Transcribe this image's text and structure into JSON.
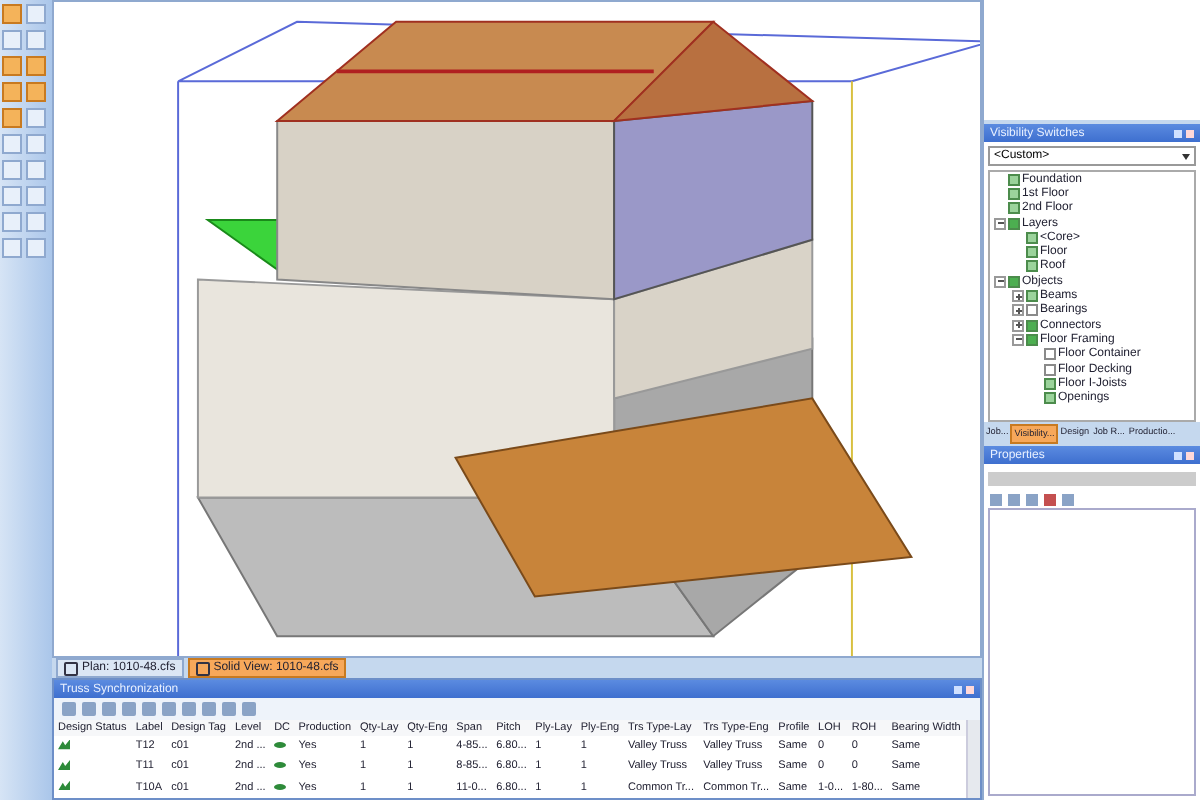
{
  "left_toolbar": {
    "tools": [
      {
        "selected": true
      },
      {
        "selected": false
      },
      {
        "selected": false
      },
      {
        "selected": false
      },
      {
        "selected": true
      },
      {
        "selected": true
      },
      {
        "selected": true
      },
      {
        "selected": true
      },
      {
        "selected": true
      },
      {
        "selected": false
      },
      {
        "selected": false
      },
      {
        "selected": false
      },
      {
        "selected": false
      },
      {
        "selected": false
      },
      {
        "selected": false
      },
      {
        "selected": false
      },
      {
        "selected": false
      },
      {
        "selected": false
      },
      {
        "selected": false
      },
      {
        "selected": false
      }
    ]
  },
  "document_tabs": [
    {
      "label": "Plan: 1010-48.cfs",
      "selected": false
    },
    {
      "label": "Solid View: 1010-48.cfs",
      "selected": true
    }
  ],
  "truss_panel": {
    "title": "Truss Synchronization",
    "columns": [
      "Design Status",
      "Label",
      "Design Tag",
      "Level",
      "DC",
      "Production",
      "Qty-Lay",
      "Qty-Eng",
      "Span",
      "Pitch",
      "Ply-Lay",
      "Ply-Eng",
      "Trs Type-Lay",
      "Trs Type-Eng",
      "Profile",
      "LOH",
      "ROH",
      "Bearing Width"
    ],
    "rows": [
      {
        "label": "T12",
        "design_tag": "c01",
        "level": "2nd ...",
        "production": "Yes",
        "qty_lay": "1",
        "qty_eng": "1",
        "span": "4-85...",
        "pitch": "6.80...",
        "ply_lay": "1",
        "ply_eng": "1",
        "trs_type_lay": "Valley Truss",
        "trs_type_eng": "Valley Truss",
        "profile": "Same",
        "loh": "0",
        "roh": "0",
        "bearing_width": "Same"
      },
      {
        "label": "T11",
        "design_tag": "c01",
        "level": "2nd ...",
        "production": "Yes",
        "qty_lay": "1",
        "qty_eng": "1",
        "span": "8-85...",
        "pitch": "6.80...",
        "ply_lay": "1",
        "ply_eng": "1",
        "trs_type_lay": "Valley Truss",
        "trs_type_eng": "Valley Truss",
        "profile": "Same",
        "loh": "0",
        "roh": "0",
        "bearing_width": "Same"
      },
      {
        "label": "T10A",
        "design_tag": "c01",
        "level": "2nd ...",
        "production": "Yes",
        "qty_lay": "1",
        "qty_eng": "1",
        "span": "11-0...",
        "pitch": "6.80...",
        "ply_lay": "1",
        "ply_eng": "1",
        "trs_type_lay": "Common Tr...",
        "trs_type_eng": "Common Tr...",
        "profile": "Same",
        "loh": "1-0...",
        "roh": "1-80...",
        "bearing_width": "Same"
      }
    ]
  },
  "visibility_panel": {
    "title": "Visibility Switches",
    "dropdown_value": "<Custom>",
    "tree": [
      {
        "label": "Foundation",
        "checked": true,
        "partial": false
      },
      {
        "label": "1st Floor",
        "checked": true,
        "partial": false
      },
      {
        "label": "2nd Floor",
        "checked": true,
        "partial": false
      },
      {
        "label": "Layers",
        "checked": true,
        "partial": true,
        "expanded": true,
        "children": [
          {
            "label": "<Core>",
            "checked": true,
            "partial": false
          },
          {
            "label": "Floor",
            "checked": true,
            "partial": false
          },
          {
            "label": "Roof",
            "checked": true,
            "partial": false
          }
        ]
      },
      {
        "label": "Objects",
        "checked": true,
        "partial": true,
        "expanded": true,
        "children": [
          {
            "label": "Beams",
            "checked": true,
            "partial": false,
            "expanded": false
          },
          {
            "label": "Bearings",
            "checked": false,
            "partial": false,
            "expanded": false
          },
          {
            "label": "Connectors",
            "checked": true,
            "partial": true,
            "expanded": false
          },
          {
            "label": "Floor Framing",
            "checked": true,
            "partial": true,
            "expanded": true,
            "children": [
              {
                "label": "Floor Container",
                "checked": false,
                "partial": false
              },
              {
                "label": "Floor Decking",
                "checked": false,
                "partial": false
              },
              {
                "label": "Floor I-Joists",
                "checked": true,
                "partial": false
              },
              {
                "label": "Openings",
                "checked": true,
                "partial": false
              }
            ]
          }
        ]
      }
    ]
  },
  "side_tabs": [
    {
      "label": "Job...",
      "selected": false
    },
    {
      "label": "Visibility...",
      "selected": true
    },
    {
      "label": "Design",
      "selected": false
    },
    {
      "label": "Job R...",
      "selected": false
    },
    {
      "label": "Productio...",
      "selected": false
    }
  ],
  "properties_panel": {
    "title": "Properties"
  }
}
